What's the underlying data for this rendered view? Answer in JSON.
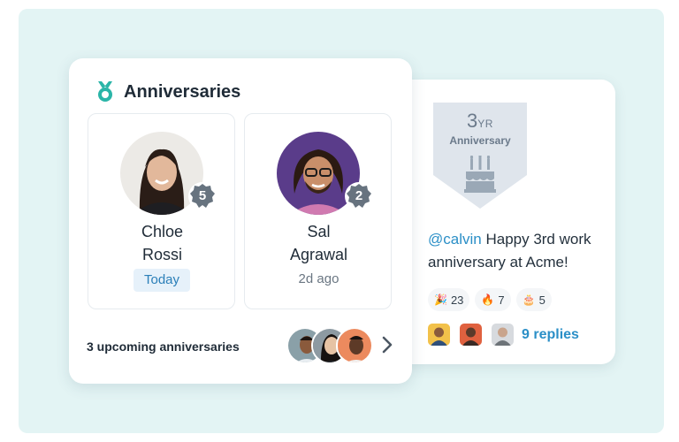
{
  "anniversaries": {
    "title": "Anniversaries",
    "people": [
      {
        "first": "Chloe",
        "last": "Rossi",
        "years": "5",
        "when": "Today"
      },
      {
        "first": "Sal",
        "last": "Agrawal",
        "years": "2",
        "when": "2d ago"
      }
    ],
    "upcoming_label": "3 upcoming anniversaries",
    "colors": {
      "accent": "#2bb5a8",
      "badge": "#67737f"
    }
  },
  "post": {
    "badge_years": "3",
    "badge_unit": "YR",
    "badge_label": "Anniversary",
    "mention": "@calvin",
    "message": " Happy 3rd work anniversary at Acme!",
    "reactions": [
      {
        "icon": "party-popper-icon",
        "emoji": "🎉",
        "count": "23"
      },
      {
        "icon": "fire-icon",
        "emoji": "🔥",
        "count": "7"
      },
      {
        "icon": "cake-icon",
        "emoji": "🎂",
        "count": "5"
      }
    ],
    "replies_label": "9 replies",
    "colors": {
      "link": "#2b8fc7"
    }
  }
}
